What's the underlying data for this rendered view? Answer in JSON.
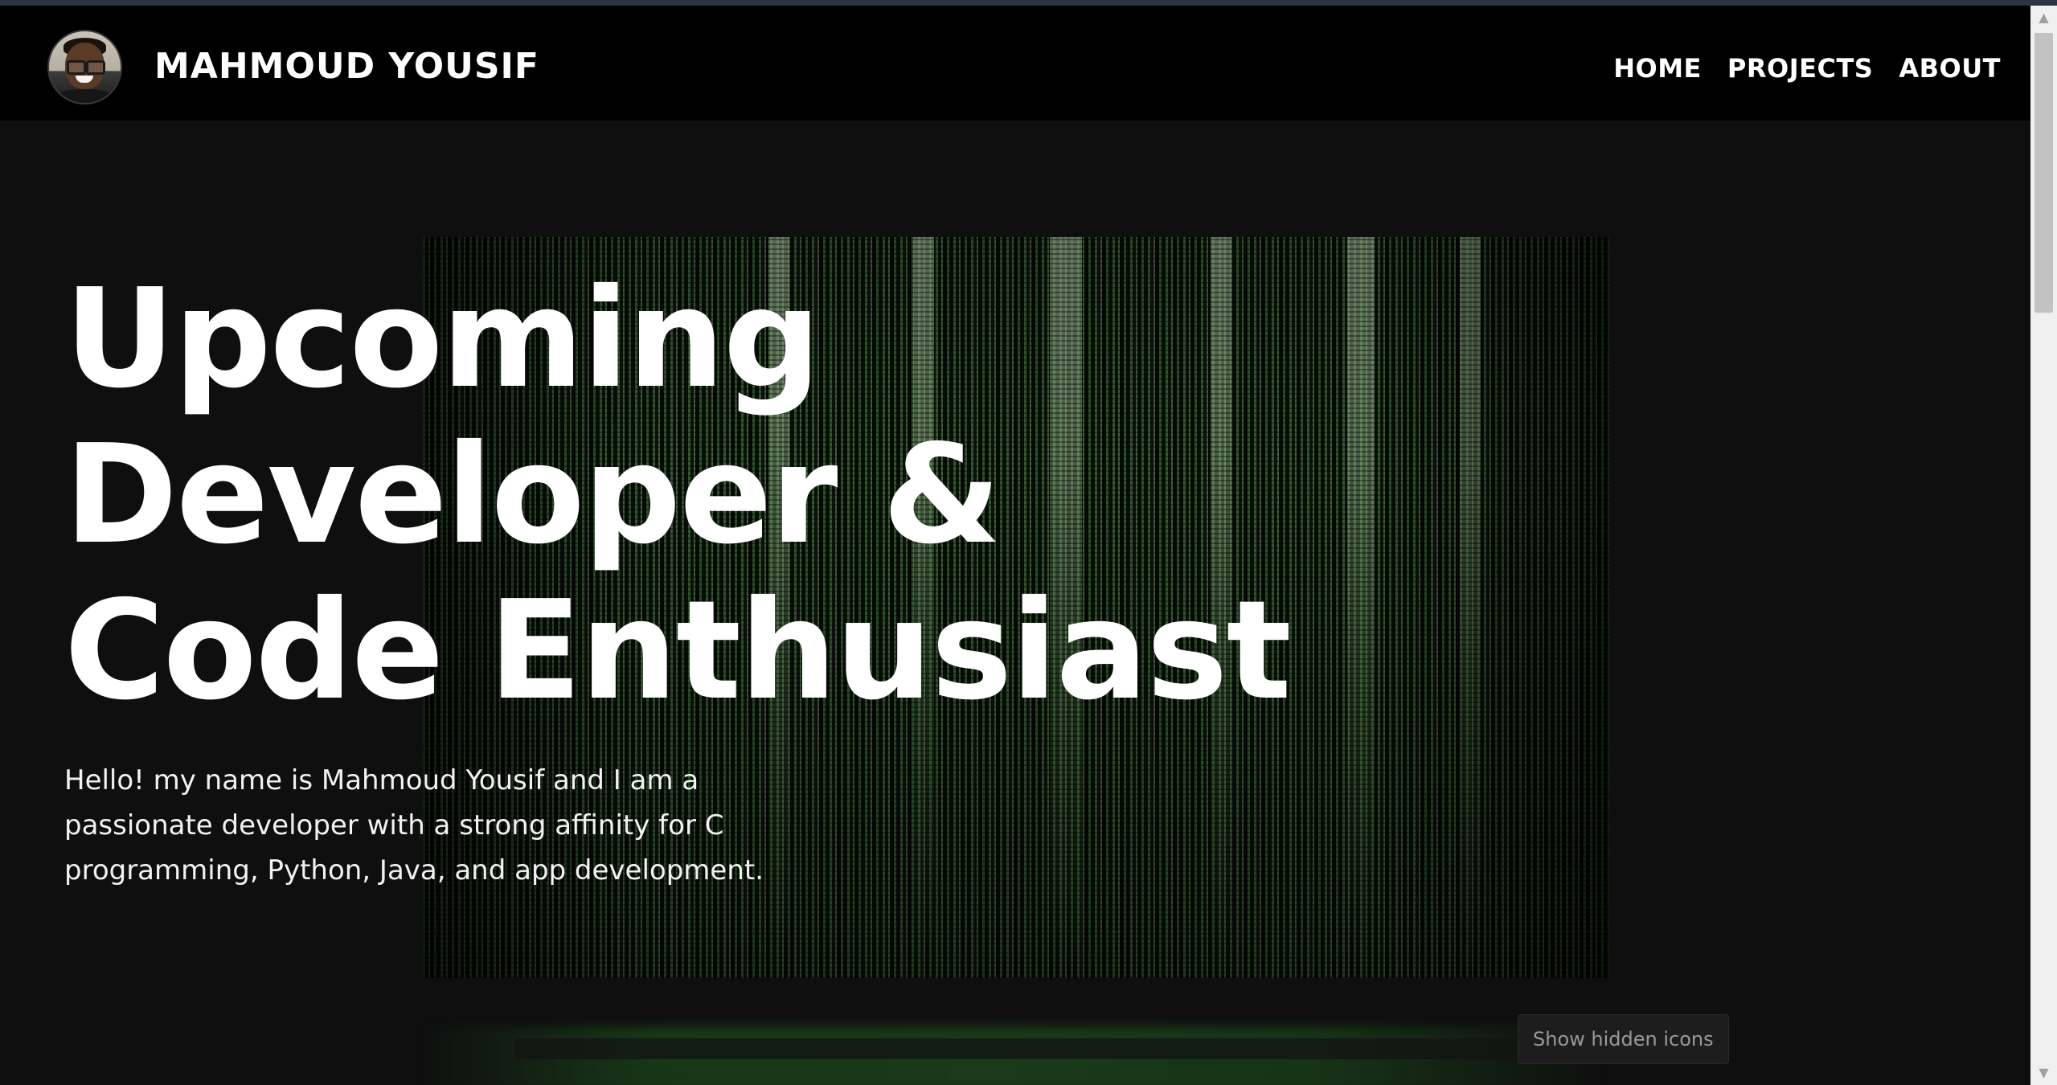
{
  "navbar": {
    "brand": "MAHMOUD YOUSIF",
    "links": [
      {
        "label": "HOME"
      },
      {
        "label": "PROJECTS"
      },
      {
        "label": "ABOUT"
      }
    ]
  },
  "hero": {
    "headline": [
      "Upcoming",
      "Developer &",
      "Code Enthusiast"
    ],
    "intro": "Hello! my name is Mahmoud Yousif and I am a passionate developer with a strong affinity for C programming, Python, Java, and app development."
  },
  "tooltip": {
    "text": "Show hidden icons"
  },
  "icons": {
    "scroll_up": "chevron-up-icon",
    "scroll_down": "chevron-down-icon"
  },
  "colors": {
    "navbar_bg": "#000000",
    "page_bg": "#0f0f0f",
    "text": "#ffffff",
    "accent_green": "#5a9650"
  }
}
